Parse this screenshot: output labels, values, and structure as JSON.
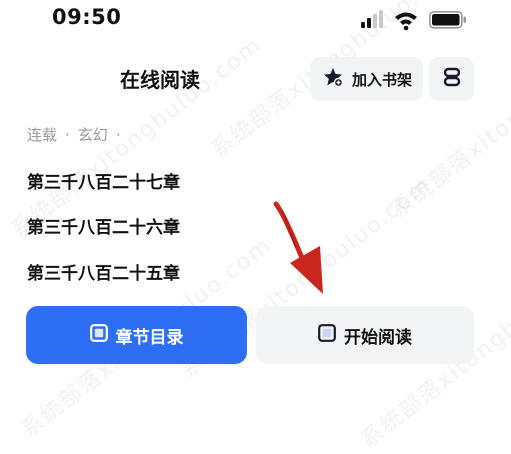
{
  "status_bar": {
    "time": "09:50",
    "icons": [
      "cellular-signal-icon",
      "wifi-icon",
      "battery-icon"
    ]
  },
  "header": {
    "title": "在线阅读",
    "add_bookshelf_label": "加入书架",
    "add_bookshelf_icon": "bookshelf-star-icon",
    "menu_icon": "menu-icon"
  },
  "book_meta": {
    "status": "连载",
    "genre": "玄幻",
    "separator": "·"
  },
  "chapters": [
    "第三千八百二十七章",
    "第三千八百二十六章",
    "第三千八百二十五章"
  ],
  "actions": {
    "toc_label": "章节目录",
    "start_reading_label": "开始阅读"
  },
  "watermark": "系统部落xitongbuluo.com",
  "colors": {
    "accent": "#2e6ef5",
    "arrow": "#c8261f",
    "button_bg": "#f3f4f6",
    "meta_text": "#9a9a9a"
  }
}
